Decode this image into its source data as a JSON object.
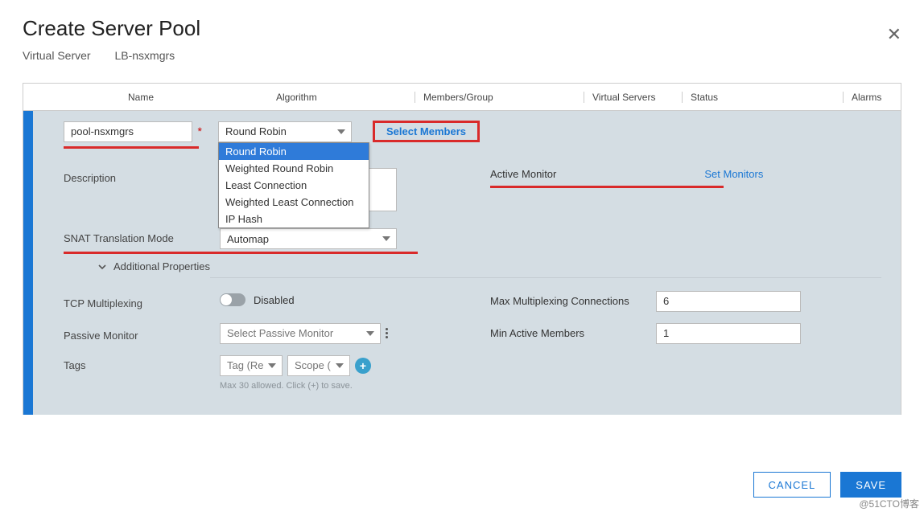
{
  "header": {
    "title": "Create Server Pool",
    "breadcrumb": [
      "Virtual Server",
      "LB-nsxmgrs"
    ]
  },
  "columns": {
    "name": "Name",
    "algorithm": "Algorithm",
    "members": "Members/Group",
    "virtual_servers": "Virtual Servers",
    "status": "Status",
    "alarms": "Alarms"
  },
  "form": {
    "name_value": "pool-nsxmgrs",
    "algorithm_selected": "Round Robin",
    "algorithm_options": [
      "Round Robin",
      "Weighted Round Robin",
      "Least Connection",
      "Weighted Least Connection",
      "IP Hash"
    ],
    "select_members_label": "Select Members",
    "description_label": "Description",
    "active_monitor_label": "Active Monitor",
    "set_monitors_label": "Set Monitors",
    "snat_label": "SNAT Translation Mode",
    "snat_value": "Automap",
    "additional_label": "Additional Properties",
    "tcp_mux_label": "TCP Multiplexing",
    "tcp_mux_state": "Disabled",
    "max_mux_label": "Max Multiplexing Connections",
    "max_mux_value": "6",
    "passive_label": "Passive Monitor",
    "passive_placeholder": "Select Passive Monitor",
    "min_active_label": "Min Active Members",
    "min_active_value": "1",
    "tags_label": "Tags",
    "tag_placeholder": "Tag (Re",
    "scope_placeholder": "Scope (",
    "tags_hint": "Max 30 allowed. Click (+) to save."
  },
  "footer": {
    "cancel": "CANCEL",
    "save": "SAVE"
  },
  "watermark": "@51CTO博客"
}
